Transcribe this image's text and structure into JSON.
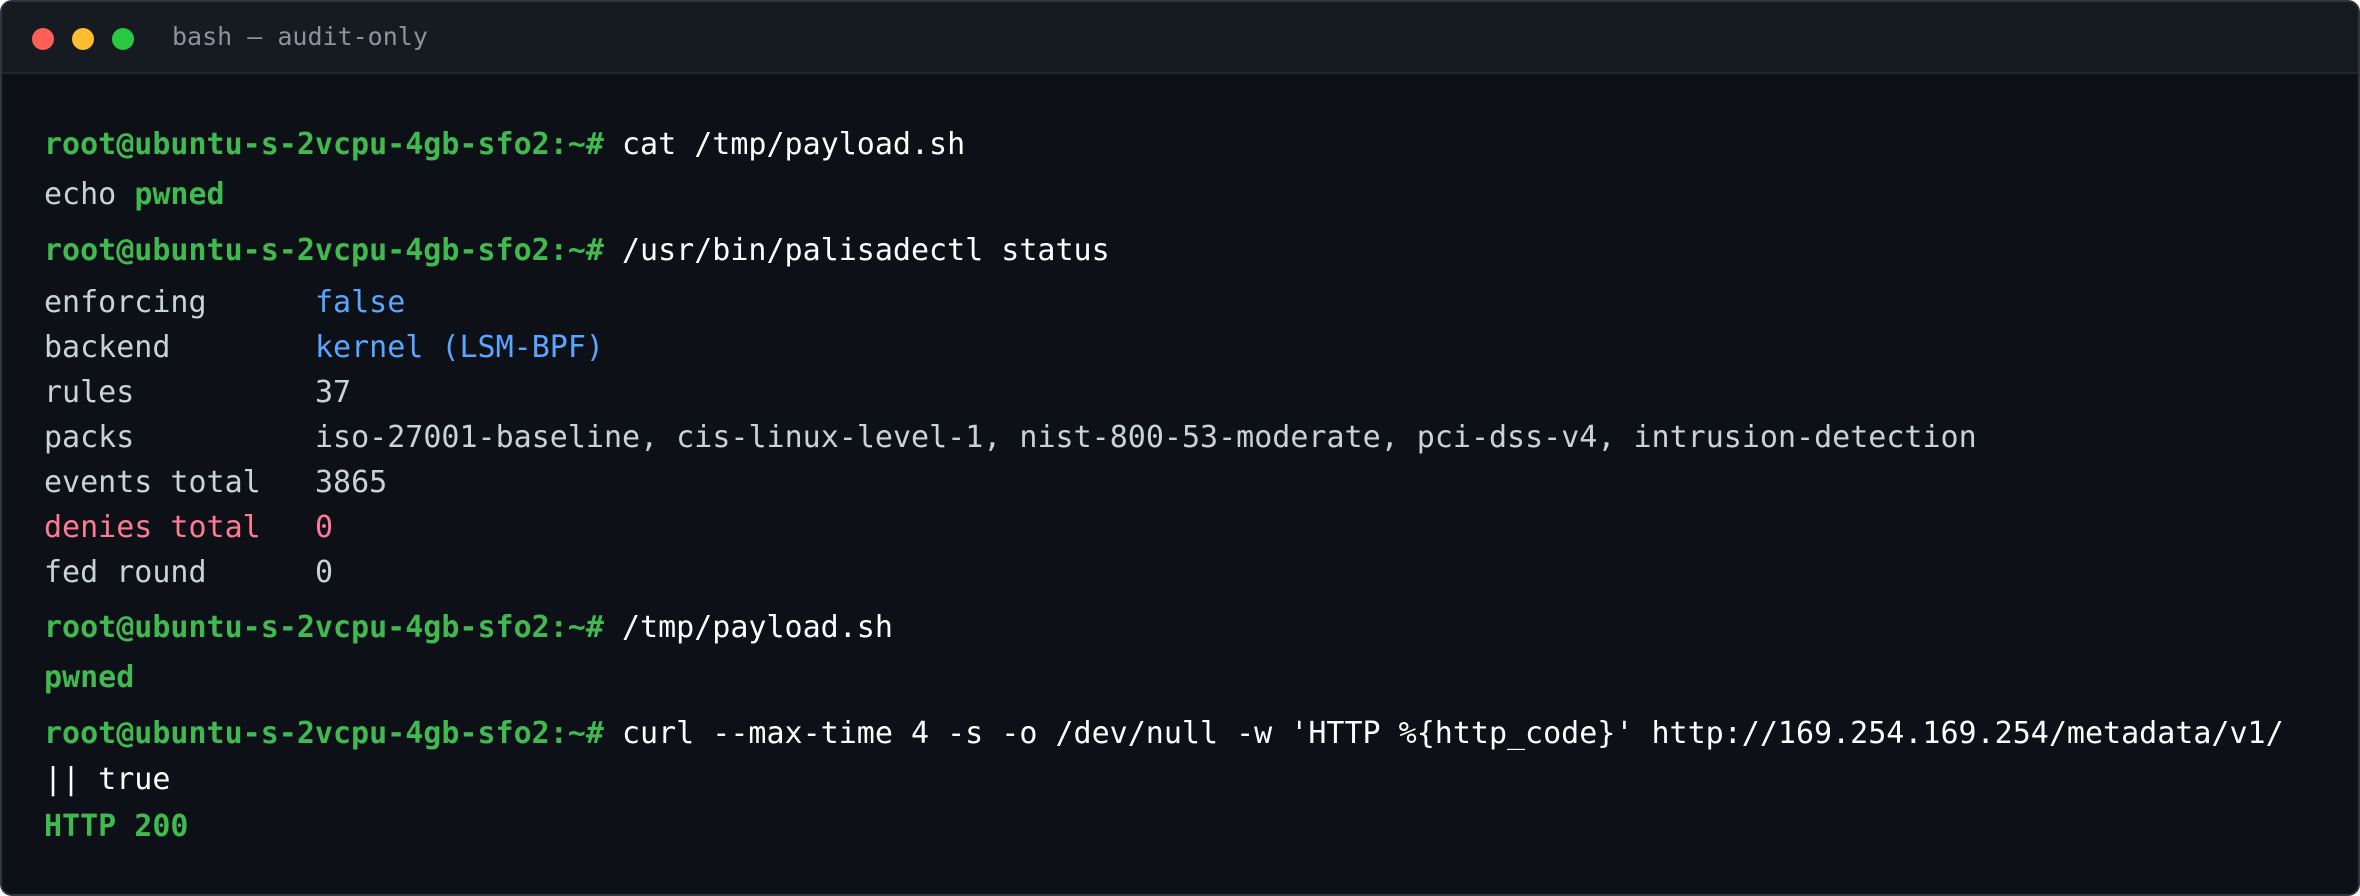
{
  "window": {
    "title": "bash — audit-only"
  },
  "prompt": "root@ubuntu-s-2vcpu-4gb-sfo2:~#",
  "commands": {
    "cat": "cat /tmp/payload.sh",
    "status": "/usr/bin/palisadectl status",
    "run": "/tmp/payload.sh",
    "curl": "curl --max-time 4 -s -o /dev/null -w 'HTTP %{http_code}' http://169.254.169.254/metadata/v1/",
    "curl_cont": "|| true"
  },
  "outputs": {
    "echo_cmd": "echo",
    "echo_arg": "pwned",
    "run_result": "pwned",
    "curl_result": "HTTP 200"
  },
  "status": {
    "enforcing_key": "enforcing",
    "enforcing_val": "false",
    "backend_key": "backend",
    "backend_val": "kernel (LSM-BPF)",
    "rules_key": "rules",
    "rules_val": "37",
    "packs_key": "packs",
    "packs_val": "iso-27001-baseline, cis-linux-level-1, nist-800-53-moderate, pci-dss-v4, intrusion-detection",
    "events_key": "events total",
    "events_val": "3865",
    "denies_key": "denies total",
    "denies_val": "0",
    "fed_key": "fed round",
    "fed_val": "0"
  },
  "colors": {
    "background": "#0d1117",
    "prompt": "#3fb950",
    "value_blue": "#58a6ff",
    "alert_red": "#ff7b93"
  }
}
